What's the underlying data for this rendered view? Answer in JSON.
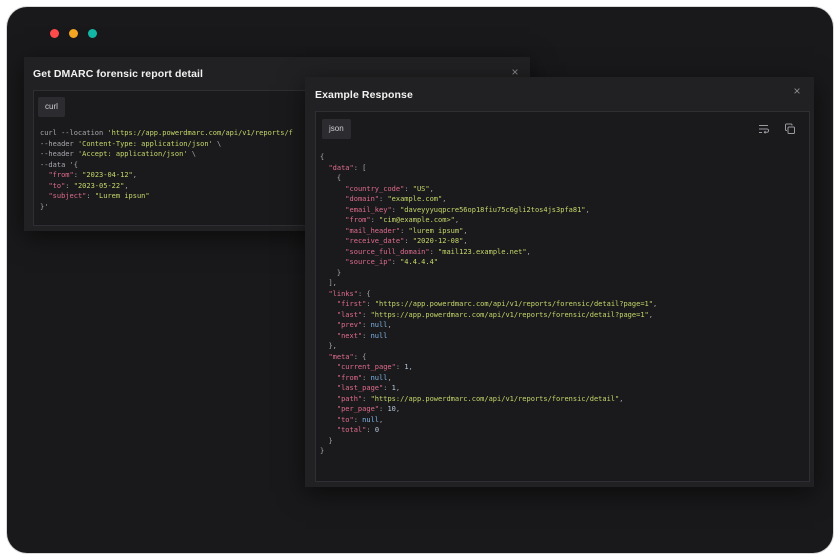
{
  "window": {
    "dots": [
      "#ff4b4b",
      "#f5a623",
      "#14b8a6"
    ]
  },
  "request_panel": {
    "title": "Get DMARC forensic report detail",
    "tab_label": "curl",
    "lines": [
      {
        "plain": "curl --location ",
        "str": "'https://app.powerdmarc.com/api/v1/reports/f",
        "tail": ""
      },
      {
        "plain": "--header ",
        "str": "'Content-Type: application/json'",
        "tail": " \\"
      },
      {
        "plain": "--header ",
        "str": "'Accept: application/json'",
        "tail": " \\"
      },
      {
        "plain": "--data '{",
        "str": "",
        "tail": ""
      },
      {
        "key": "\"from\"",
        "val": "\"2023-04-12\"",
        "end": ","
      },
      {
        "key": "\"to\"",
        "val": "\"2023-05-22\"",
        "end": ","
      },
      {
        "key": "\"subject\"",
        "val": "\"Lurem ipsun\"",
        "end": ""
      },
      {
        "plain": "}'",
        "str": "",
        "tail": ""
      }
    ]
  },
  "response_panel": {
    "title": "Example Response",
    "tab_label": "json",
    "json": {
      "data": [
        {
          "country_code": "US",
          "domain": "example.com",
          "email_key": "daveyyyuqpcre56op18fiu75c6gli2tos4js3pfa81",
          "from": "cim@example.com>",
          "mail_header": "lurem ipsum",
          "receive_date": "2020-12-08",
          "source_full_domain": "mail123.example.net",
          "source_ip": "4.4.4.4"
        }
      ],
      "links": {
        "first": "https://app.powerdmarc.com/api/v1/reports/forensic/detail?page=1",
        "last": "https://app.powerdmarc.com/api/v1/reports/forensic/detail?page=1",
        "prev": null,
        "next": null
      },
      "meta": {
        "current_page": 1,
        "from": null,
        "last_page": 1,
        "path": "https://app.powerdmarc.com/api/v1/reports/forensic/detail",
        "per_page": 10,
        "to": null,
        "total": 0
      }
    }
  },
  "icons": {
    "wrap": "wrap-lines-icon",
    "copy": "copy-icon",
    "close": "close-icon"
  }
}
